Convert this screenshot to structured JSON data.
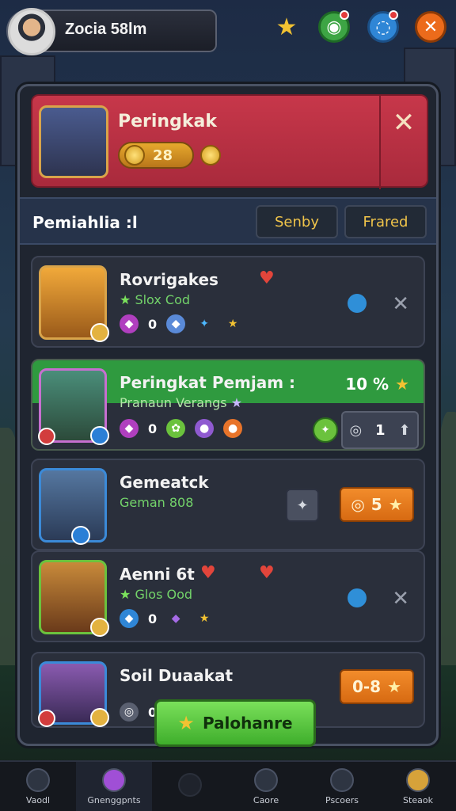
{
  "profile": {
    "name": "Zocia 58lm"
  },
  "top_icons": [
    {
      "name": "star-icon",
      "color": "#f2c232"
    },
    {
      "name": "compass-icon",
      "color": "#3da544"
    },
    {
      "name": "globe-icon",
      "color": "#2f86d6"
    },
    {
      "name": "close-icon",
      "color": "#ec6b1b"
    }
  ],
  "header": {
    "title": "Peringkak",
    "coins": "28"
  },
  "subbar": {
    "label": "Pemiahlia :l",
    "btn_left": "Senby",
    "btn_right": "Frared"
  },
  "rows": [
    {
      "name": "Rovrigakes",
      "sub": "Slox Cod",
      "val": "0"
    },
    {
      "name": "Peringkat Pemjam :",
      "sub": "Pranaun Verangs",
      "badge": "10 %",
      "val": "0",
      "count": "1"
    },
    {
      "name": "Gemeatck",
      "sub": "Geman 808",
      "badge": "5"
    },
    {
      "name": "Aenni 6t",
      "sub": "Glos Ood",
      "val": "0"
    },
    {
      "name": "Soil Duaakat",
      "badge": "0-8",
      "val": "0"
    }
  ],
  "play_button": {
    "label": "Palohanre"
  },
  "bottom_nav": [
    {
      "label": "Vaodl"
    },
    {
      "label": "Gnenggpnts"
    },
    {
      "label": ""
    },
    {
      "label": "Caore"
    },
    {
      "label": "Pscoers"
    },
    {
      "label": "Steaok"
    }
  ]
}
